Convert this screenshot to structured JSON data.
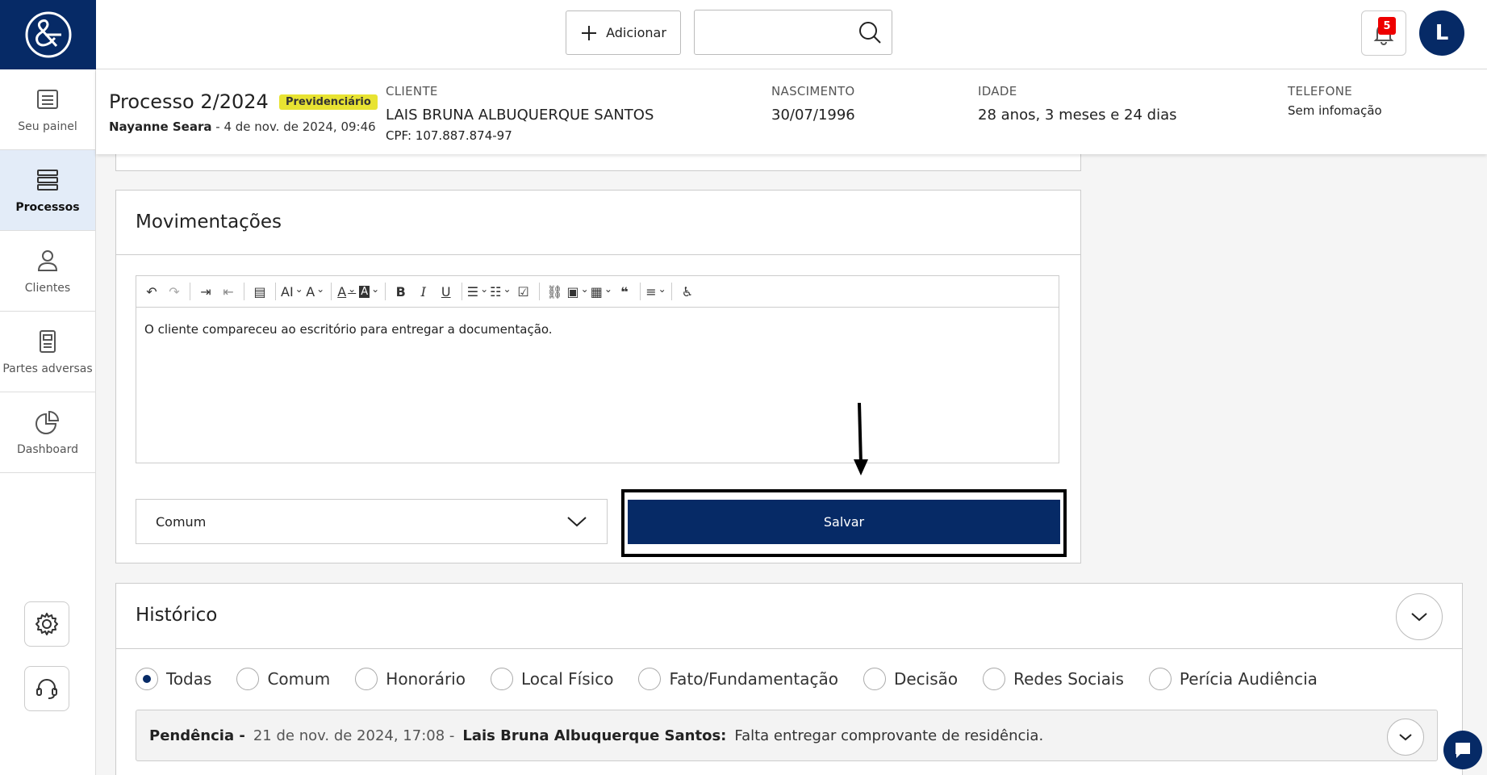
{
  "sidebar": {
    "logo_icon": "ampersand-logo-icon",
    "items": [
      {
        "label": "Seu painel",
        "icon": "list-icon",
        "active": false
      },
      {
        "label": "Processos",
        "icon": "stack-icon",
        "active": true
      },
      {
        "label": "Clientes",
        "icon": "person-icon",
        "active": false
      },
      {
        "label": "Partes adversas",
        "icon": "document-icon",
        "active": false
      },
      {
        "label": "Dashboard",
        "icon": "pie-chart-icon",
        "active": false
      }
    ],
    "settings_icon": "gear-icon",
    "support_icon": "headset-icon"
  },
  "topbar": {
    "add_label": "Adicionar",
    "search_placeholder": "",
    "notification_count": "5",
    "avatar_initial": "L"
  },
  "process": {
    "title": "Processo 2/2024",
    "tag": "Previdenciário",
    "author": "Nayanne Seara",
    "date": " - 4 de nov. de 2024, 09:46",
    "client_label": "CLIENTE",
    "client_name": "LAIS BRUNA ALBUQUERQUE SANTOS",
    "client_cpf": "CPF: 107.887.874-97",
    "birth_label": "NASCIMENTO",
    "birth_value": "30/07/1996",
    "age_label": "IDADE",
    "age_value": "28 anos, 3 meses e 24 dias",
    "phone_label": "TELEFONE",
    "phone_value": "Sem infomação"
  },
  "movimentacoes": {
    "title": "Movimentações",
    "editor_text": "O cliente compareceu ao escritório para entregar a documentação.",
    "type_value": "Comum",
    "save_label": "Salvar"
  },
  "historico": {
    "title": "Histórico",
    "filters": [
      {
        "label": "Todas",
        "selected": true
      },
      {
        "label": "Comum",
        "selected": false
      },
      {
        "label": "Honorário",
        "selected": false
      },
      {
        "label": "Local Físico",
        "selected": false
      },
      {
        "label": "Fato/Fundamentação",
        "selected": false
      },
      {
        "label": "Decisão",
        "selected": false
      },
      {
        "label": "Redes Sociais",
        "selected": false
      },
      {
        "label": "Perícia Audiência",
        "selected": false
      }
    ],
    "entry": {
      "type": "Pendência -",
      "date": "21 de nov. de 2024, 17:08 -",
      "author": "Lais Bruna Albuquerque Santos:",
      "text": "Falta entregar comprovante de residência."
    }
  },
  "colors": {
    "brand": "#062a66",
    "tag": "#e8e332",
    "badge": "#e00000"
  }
}
